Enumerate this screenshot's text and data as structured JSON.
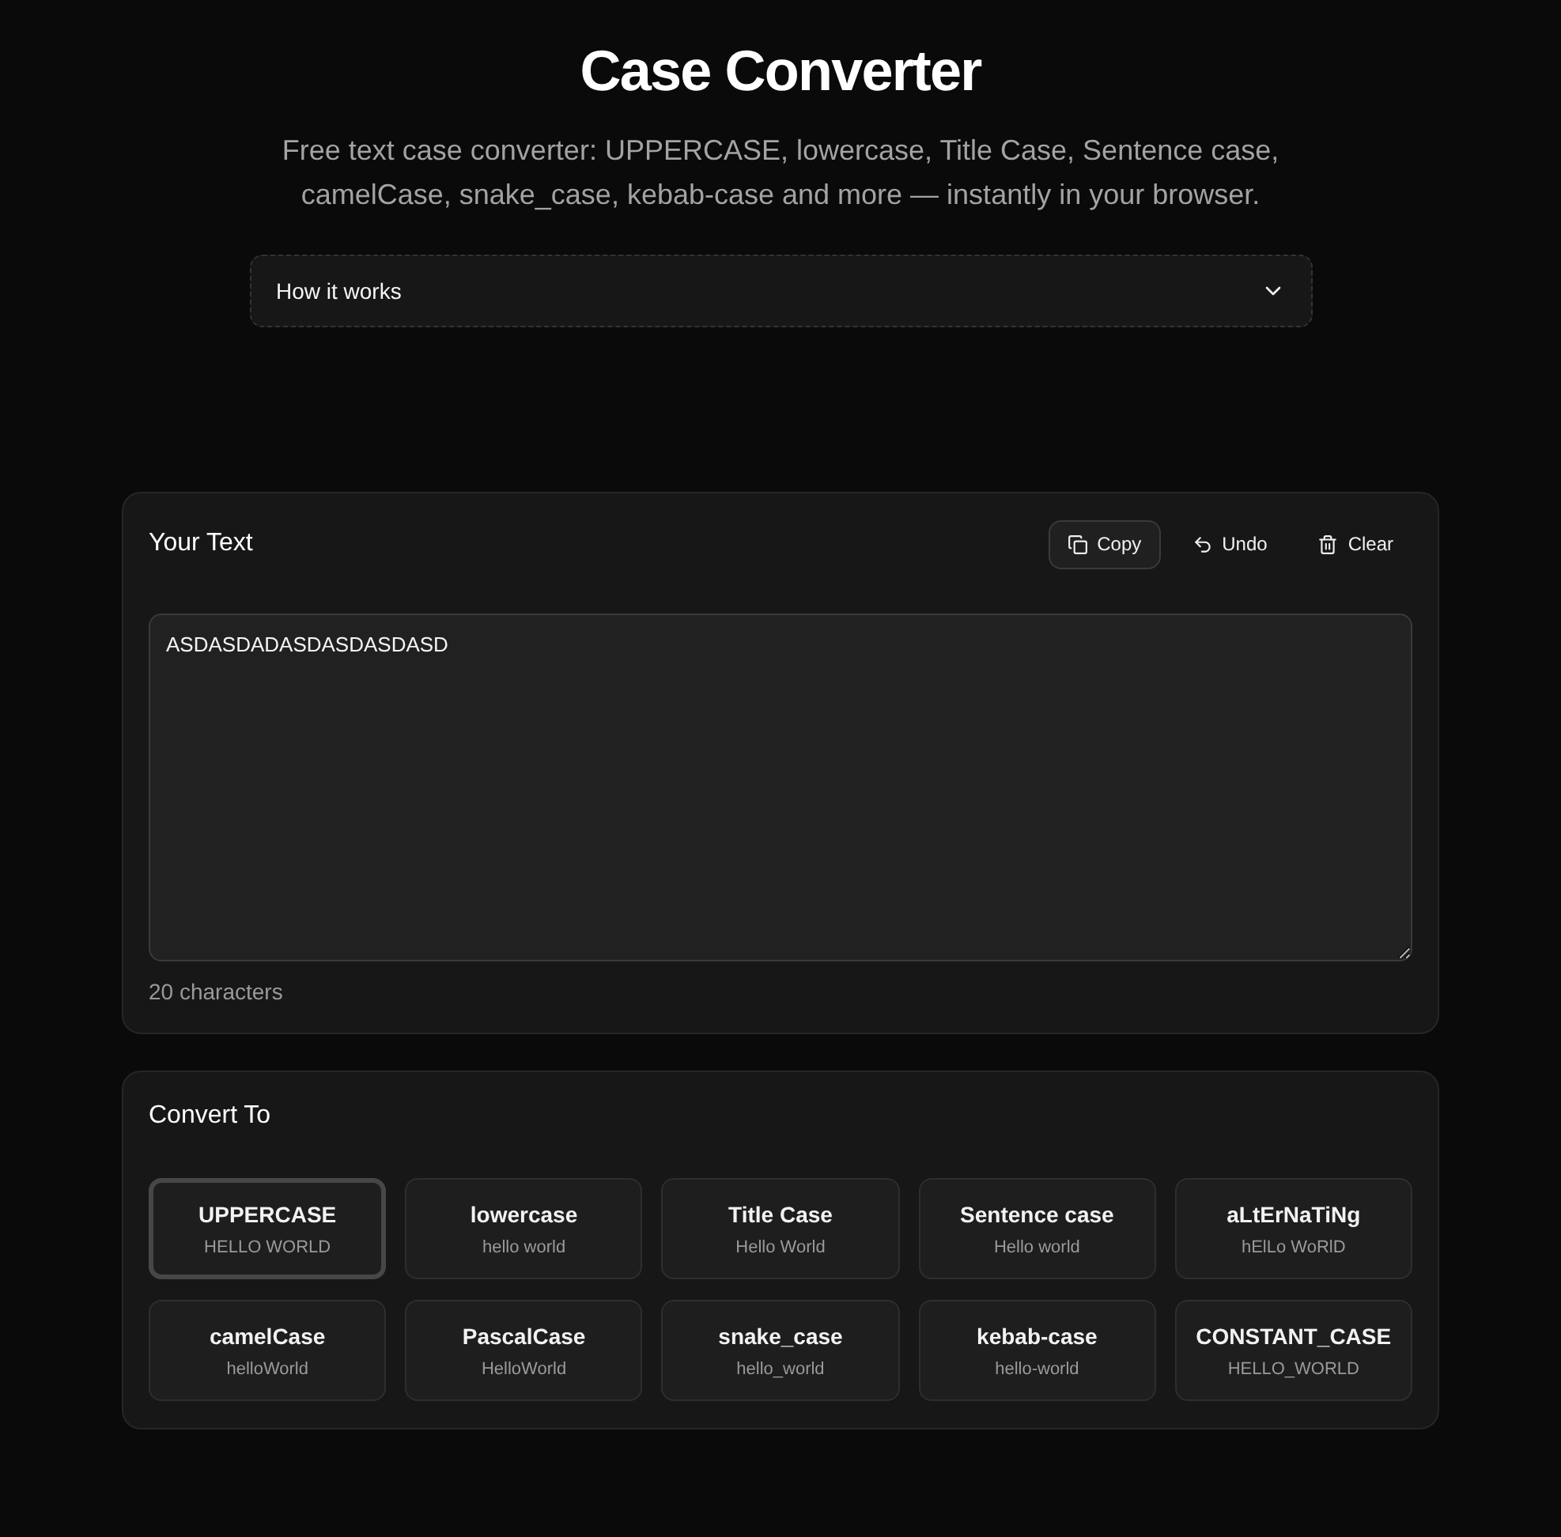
{
  "page": {
    "title": "Case Converter",
    "subtitle": "Free text case converter: UPPERCASE, lowercase, Title Case, Sentence case, camelCase, snake_case, kebab-case and more — instantly in your browser."
  },
  "accordion": {
    "label": "How it works",
    "expanded": false
  },
  "input_card": {
    "title": "Your Text",
    "buttons": [
      {
        "label": "Copy",
        "kind": "outline"
      },
      {
        "label": "Undo",
        "kind": "ghost"
      },
      {
        "label": "Clear",
        "kind": "ghost"
      }
    ],
    "text_area": {
      "value": "ASDASDADASDASDASDASD"
    },
    "count": "20 characters"
  },
  "convert_card": {
    "title": "Convert To",
    "options": [
      {
        "label": "UPPERCASE",
        "example": "HELLO WORLD",
        "selected": true
      },
      {
        "label": "lowercase",
        "example": "hello world",
        "selected": false
      },
      {
        "label": "Title Case",
        "example": "Hello World",
        "selected": false
      },
      {
        "label": "Sentence case",
        "example": "Hello world",
        "selected": false
      },
      {
        "label": "aLtErNaTiNg",
        "example": "hElLo WoRlD",
        "selected": false
      },
      {
        "label": "camelCase",
        "example": "helloWorld",
        "selected": false
      },
      {
        "label": "PascalCase",
        "example": "HelloWorld",
        "selected": false
      },
      {
        "label": "snake_case",
        "example": "hello_world",
        "selected": false
      },
      {
        "label": "kebab-case",
        "example": "hello-world",
        "selected": false
      },
      {
        "label": "CONSTANT_CASE",
        "example": "HELLO_WORLD",
        "selected": false
      }
    ]
  }
}
